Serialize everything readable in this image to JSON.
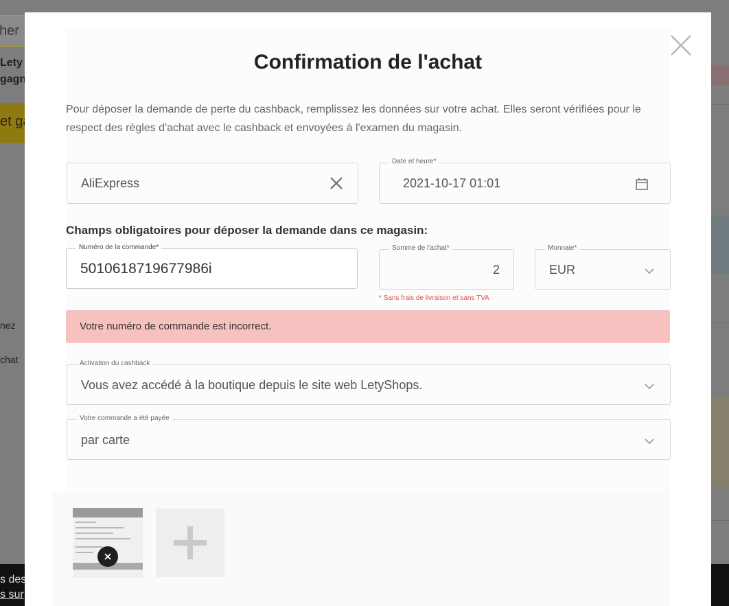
{
  "background": {
    "search_text": "her",
    "heading_line1": "Lety",
    "heading_line2": "gagn",
    "cta_text": "et ga",
    "side_text_1": "nez",
    "side_text_2": "chat",
    "cookie_line1": "s des",
    "cookie_line2": "s sur"
  },
  "modal": {
    "title": "Confirmation de l'achat",
    "description": "Pour déposer la demande de perte du cashback, remplissez les données sur votre achat. Elles seront vérifiées pour le respect des règles d'achat avec le cashback et envoyées à l'examen du magasin.",
    "store_value": "AliExpress",
    "date_label": "Date et heure*",
    "date_value": "2021-10-17 01:01",
    "required_heading": "Champs obligatoires pour déposer la demande dans ce magasin:",
    "order_number_label": "Numéro de la commande*",
    "order_number_value": "5010618719677986i",
    "amount_label": "Somme de l'achat*",
    "amount_value": "2",
    "currency_label": "Monnaie*",
    "currency_value": "EUR",
    "amount_hint": "* Sans frais de livraison et sans TVA",
    "error_message": "Votre numéro de commande est incorrect.",
    "activation_label": "Activation du cashback",
    "activation_value": "Vous avez accédé à la boutique depuis le site web LetyShops.",
    "payment_label": "Votre commande a été payée",
    "payment_value": "par carte"
  },
  "icons": {
    "close": "close-icon",
    "clear": "clear-icon",
    "calendar": "calendar-icon",
    "chevron": "chevron-down-icon",
    "add": "plus-icon"
  },
  "colors": {
    "error_background": "#f7c1c0",
    "hint_red": "#e04a4a",
    "overlay": "#7d7d7d"
  }
}
